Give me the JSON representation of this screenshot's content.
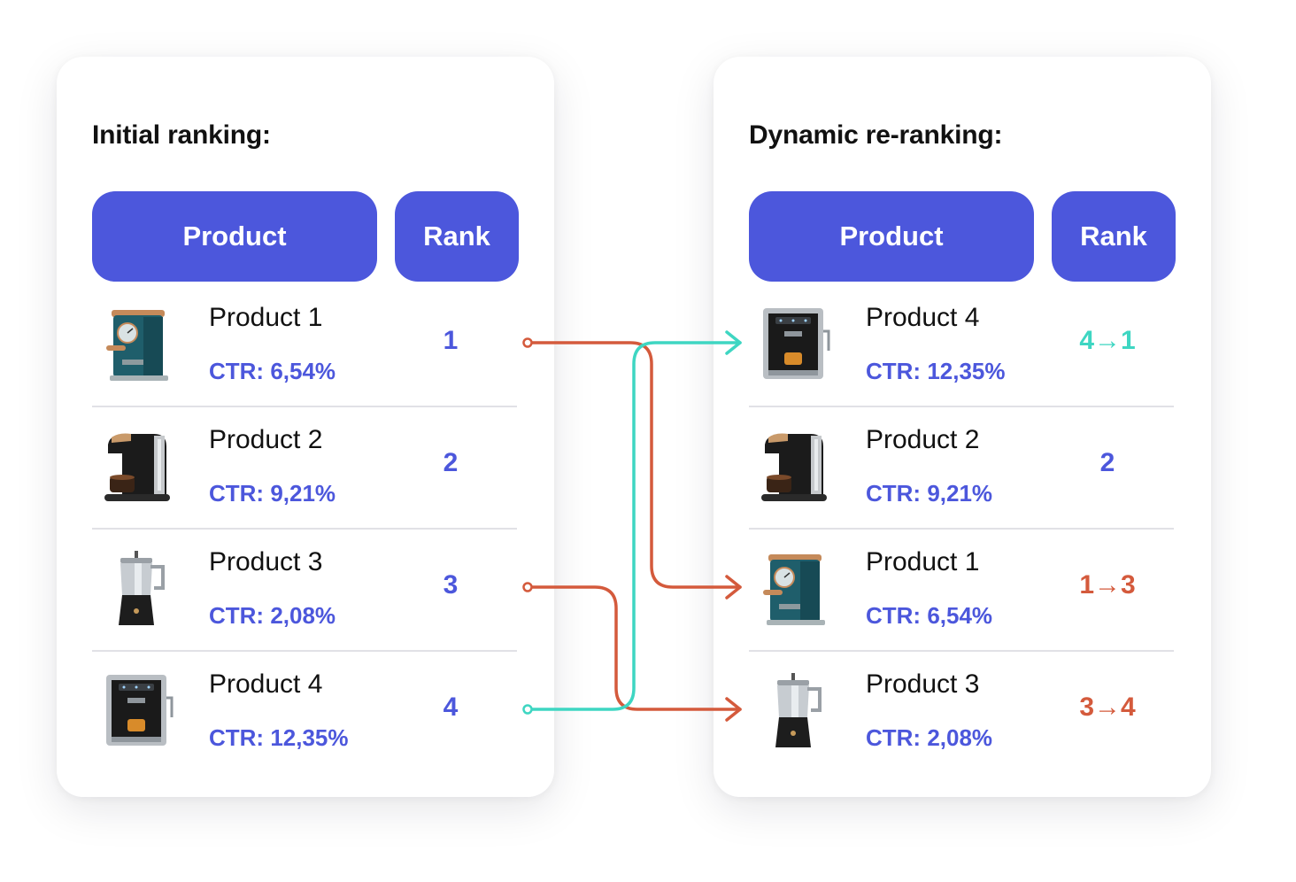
{
  "initial": {
    "title": "Initial ranking:",
    "product_header": "Product",
    "rank_header": "Rank",
    "rows": [
      {
        "name": "Product 1",
        "ctr": "CTR: 6,54%",
        "rank": "1",
        "image": "teal-espresso-machine"
      },
      {
        "name": "Product 2",
        "ctr": "CTR: 9,21%",
        "rank": "2",
        "image": "black-capsule-machine"
      },
      {
        "name": "Product 3",
        "ctr": "CTR: 2,08%",
        "rank": "3",
        "image": "steel-moka-pot"
      },
      {
        "name": "Product 4",
        "ctr": "CTR: 12,35%",
        "rank": "4",
        "image": "steel-espresso-machine"
      }
    ]
  },
  "reranked": {
    "title": "Dynamic re-ranking:",
    "product_header": "Product",
    "rank_header": "Rank",
    "rows": [
      {
        "name": "Product 4",
        "ctr": "CTR: 12,35%",
        "rank": "4→1",
        "image": "steel-espresso-machine",
        "rank_color": "#3ed6c2"
      },
      {
        "name": "Product 2",
        "ctr": "CTR: 9,21%",
        "rank": "2",
        "image": "black-capsule-machine",
        "rank_color": "#4c57dc"
      },
      {
        "name": "Product 1",
        "ctr": "CTR: 6,54%",
        "rank": "1→3",
        "image": "teal-espresso-machine",
        "rank_color": "#d45a3c"
      },
      {
        "name": "Product 3",
        "ctr": "CTR: 2,08%",
        "rank": "3→4",
        "image": "steel-moka-pot",
        "rank_color": "#d45a3c"
      }
    ]
  },
  "colors": {
    "accent": "#4c57dc",
    "rank_up": "#3ed6c2",
    "rank_down": "#d45a3c"
  }
}
